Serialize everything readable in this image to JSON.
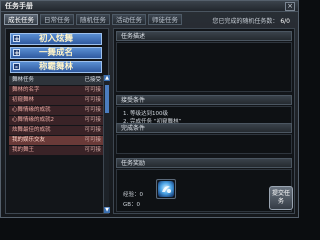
{
  "window": {
    "title": "任务手册",
    "close_label": "×"
  },
  "tabs": [
    {
      "label": "成长任务",
      "active": true
    },
    {
      "label": "日常任务",
      "active": false
    },
    {
      "label": "随机任务",
      "active": false
    },
    {
      "label": "活动任务",
      "active": false
    },
    {
      "label": "师徒任务",
      "active": false
    }
  ],
  "quest_count": {
    "label": "您已完成的随机任务数：",
    "value": "6/0"
  },
  "categories": [
    {
      "sign": "+",
      "label": "初入炫舞"
    },
    {
      "sign": "+",
      "label": "一舞成名"
    },
    {
      "sign": "-",
      "label": "称霸舞林"
    }
  ],
  "quest_list": {
    "header_name": "舞林任务",
    "header_state": "已接受",
    "rows": [
      {
        "name": "舞林的名字",
        "state": "可可接"
      },
      {
        "name": "初窥舞林",
        "state": "可可接"
      },
      {
        "name": "心舞情缘的成就",
        "state": "可可接"
      },
      {
        "name": "心舞情缘的成就2",
        "state": "可可接"
      },
      {
        "name": "炫舞最佳的成就",
        "state": "可可接"
      },
      {
        "name": "我的娱乐交友",
        "state": "可可接"
      },
      {
        "name": "我的舞王",
        "state": "可可接"
      }
    ]
  },
  "detail": {
    "desc_title": "任务描述",
    "accept_title": "接受条件",
    "accept_lines": [
      "1. 等级达到100级",
      "2. 完成任务 “初窥舞林”"
    ],
    "complete_title": "完成条件",
    "reward_title": "任务奖励",
    "reward_exp": "经验：0",
    "reward_gold": "GB：0",
    "submit_label": "提交任务"
  },
  "colors": {
    "accent": "#3a6fb0",
    "category_fill": "#4a7fc6",
    "row_fill": "#3a2327"
  },
  "icons": {
    "reward": "reward-item-icon",
    "close": "close-icon"
  }
}
